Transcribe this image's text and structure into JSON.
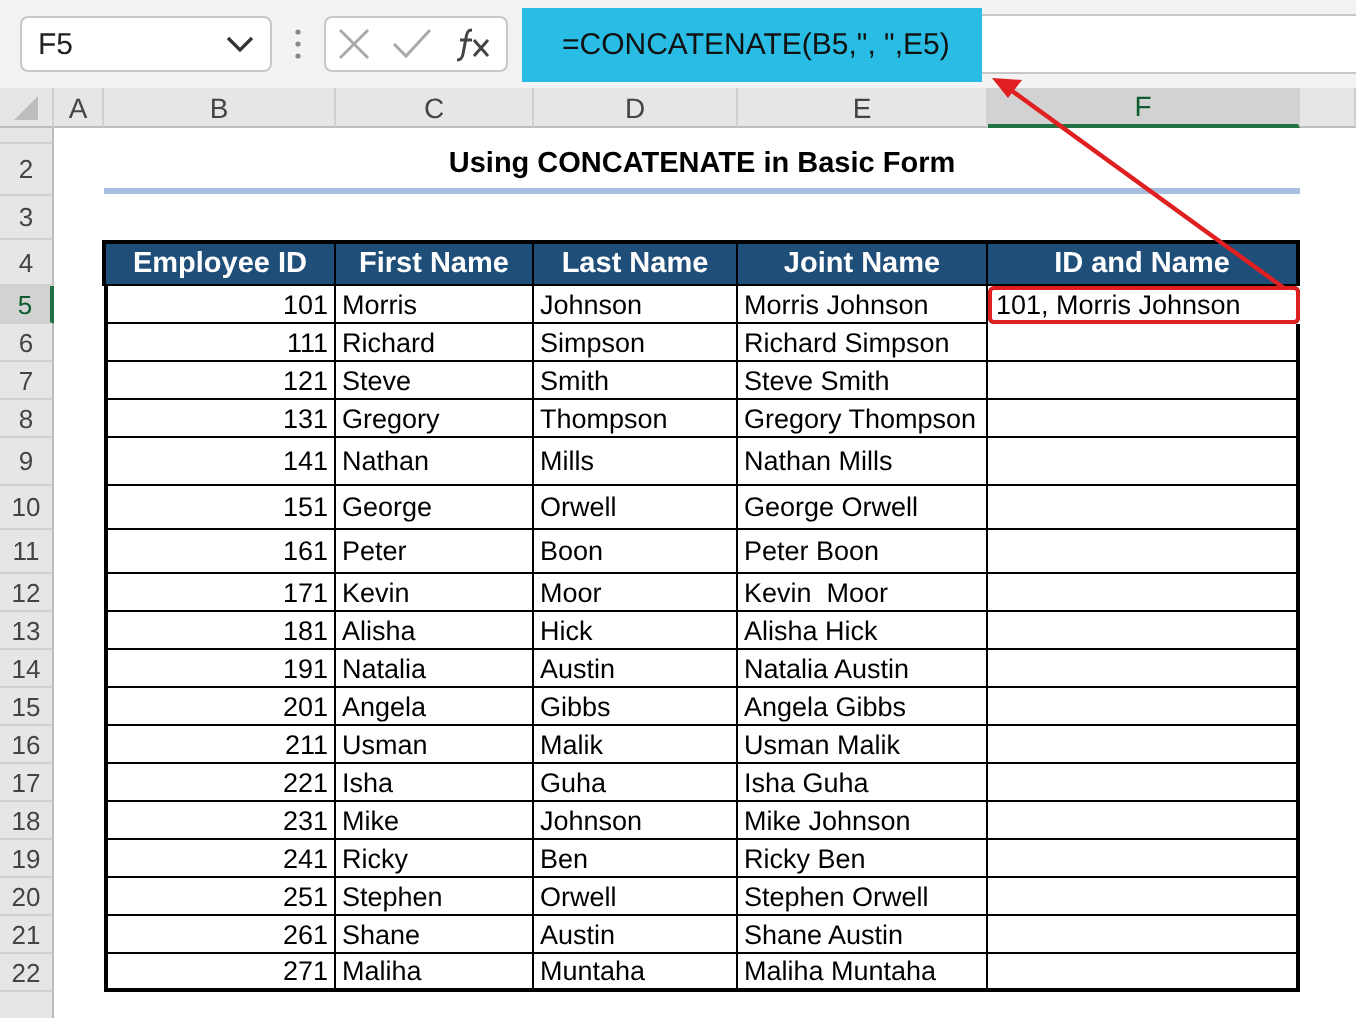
{
  "name_box": {
    "value": "F5"
  },
  "formula_bar": {
    "formula": "=CONCATENATE(B5,\", \",E5)",
    "highlighted": true
  },
  "columns": [
    {
      "label": "A",
      "selected": false
    },
    {
      "label": "B",
      "selected": false
    },
    {
      "label": "C",
      "selected": false
    },
    {
      "label": "D",
      "selected": false
    },
    {
      "label": "E",
      "selected": false
    },
    {
      "label": "F",
      "selected": true
    }
  ],
  "row_numbers": [
    {
      "label": "2",
      "selected": false
    },
    {
      "label": "3",
      "selected": false
    },
    {
      "label": "4",
      "selected": false
    },
    {
      "label": "5",
      "selected": true
    },
    {
      "label": "6",
      "selected": false
    },
    {
      "label": "7",
      "selected": false
    },
    {
      "label": "8",
      "selected": false
    },
    {
      "label": "9",
      "selected": false
    },
    {
      "label": "10",
      "selected": false
    },
    {
      "label": "11",
      "selected": false
    },
    {
      "label": "12",
      "selected": false
    },
    {
      "label": "13",
      "selected": false
    },
    {
      "label": "14",
      "selected": false
    },
    {
      "label": "15",
      "selected": false
    },
    {
      "label": "16",
      "selected": false
    },
    {
      "label": "17",
      "selected": false
    },
    {
      "label": "18",
      "selected": false
    },
    {
      "label": "19",
      "selected": false
    },
    {
      "label": "20",
      "selected": false
    },
    {
      "label": "21",
      "selected": false
    },
    {
      "label": "22",
      "selected": false
    }
  ],
  "title": "Using CONCATENATE in Basic Form",
  "table": {
    "columns": [
      "Employee ID",
      "First Name",
      "Last Name",
      "Joint Name",
      "ID and Name"
    ],
    "rows": [
      {
        "cells": [
          "101",
          "Morris",
          "Johnson",
          "Morris Johnson",
          "101, Morris Johnson"
        ],
        "highlighted": true
      },
      {
        "cells": [
          "111",
          "Richard",
          "Simpson",
          "Richard Simpson"
        ],
        "highlighted": false
      },
      {
        "cells": [
          "121",
          "Steve",
          "Smith",
          "Steve Smith"
        ],
        "highlighted": false
      },
      {
        "cells": [
          "131",
          "Gregory",
          "Thompson",
          "Gregory Thompson"
        ],
        "highlighted": false
      },
      {
        "cells": [
          "141",
          "Nathan",
          "Mills",
          "Nathan Mills"
        ],
        "highlighted": false
      },
      {
        "cells": [
          "151",
          "George",
          "Orwell",
          "George Orwell"
        ],
        "highlighted": false
      },
      {
        "cells": [
          "161",
          "Peter",
          "Boon",
          "Peter Boon"
        ],
        "highlighted": false
      },
      {
        "cells": [
          "171",
          "Kevin",
          "Moor",
          "Kevin  Moor"
        ],
        "highlighted": false
      },
      {
        "cells": [
          "181",
          "Alisha",
          "Hick",
          "Alisha Hick"
        ],
        "highlighted": false
      },
      {
        "cells": [
          "191",
          "Natalia",
          "Austin",
          "Natalia Austin"
        ],
        "highlighted": false
      },
      {
        "cells": [
          "201",
          "Angela",
          "Gibbs",
          "Angela Gibbs"
        ],
        "highlighted": false
      },
      {
        "cells": [
          "211",
          "Usman",
          "Malik",
          "Usman Malik"
        ],
        "highlighted": false
      },
      {
        "cells": [
          "221",
          "Isha",
          "Guha",
          "Isha Guha"
        ],
        "highlighted": false
      },
      {
        "cells": [
          "231",
          "Mike",
          "Johnson",
          "Mike Johnson"
        ],
        "highlighted": false
      },
      {
        "cells": [
          "241",
          "Ricky",
          "Ben",
          "Ricky Ben"
        ],
        "highlighted": false
      },
      {
        "cells": [
          "251",
          "Stephen",
          "Orwell",
          "Stephen Orwell"
        ],
        "highlighted": false
      },
      {
        "cells": [
          "261",
          "Shane",
          "Austin",
          "Shane Austin"
        ],
        "highlighted": false
      },
      {
        "cells": [
          "271",
          "Maliha",
          "Muntaha",
          "Maliha Muntaha"
        ],
        "highlighted": false
      }
    ]
  }
}
